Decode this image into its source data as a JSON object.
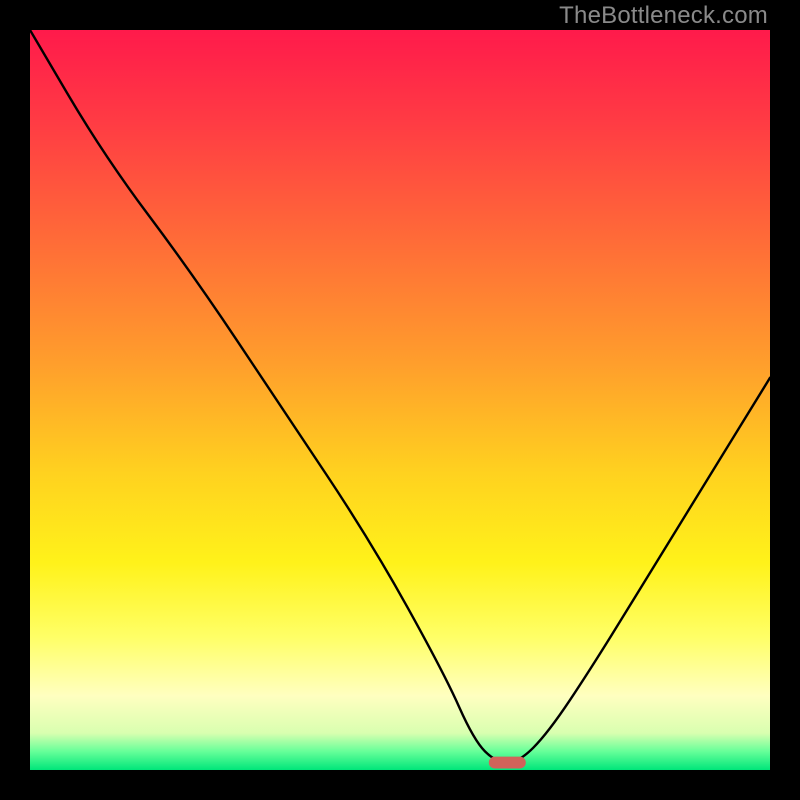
{
  "watermark": "TheBottleneck.com",
  "gradient": {
    "stops": [
      {
        "offset": 0.0,
        "color": "#ff1a4b"
      },
      {
        "offset": 0.12,
        "color": "#ff3a44"
      },
      {
        "offset": 0.28,
        "color": "#ff6a38"
      },
      {
        "offset": 0.45,
        "color": "#ff9e2c"
      },
      {
        "offset": 0.6,
        "color": "#ffd21f"
      },
      {
        "offset": 0.72,
        "color": "#fff21a"
      },
      {
        "offset": 0.82,
        "color": "#ffff66"
      },
      {
        "offset": 0.9,
        "color": "#ffffc0"
      },
      {
        "offset": 0.95,
        "color": "#d9ffb0"
      },
      {
        "offset": 0.975,
        "color": "#66ff99"
      },
      {
        "offset": 1.0,
        "color": "#00e67a"
      }
    ]
  },
  "chart_data": {
    "type": "line",
    "title": "",
    "xlabel": "",
    "ylabel": "",
    "xlim": [
      0,
      100
    ],
    "ylim": [
      0,
      100
    ],
    "series": [
      {
        "name": "bottleneck-curve",
        "x": [
          0,
          10,
          22,
          34,
          46,
          56,
          60,
          63,
          66,
          70,
          76,
          84,
          92,
          100
        ],
        "y": [
          100,
          83,
          67,
          49,
          31,
          13,
          4,
          1,
          1,
          5,
          14,
          27,
          40,
          53
        ]
      }
    ],
    "marker": {
      "x": 64.5,
      "y": 1.0,
      "w": 5.0,
      "h": 1.6,
      "color": "#d1635a"
    }
  }
}
